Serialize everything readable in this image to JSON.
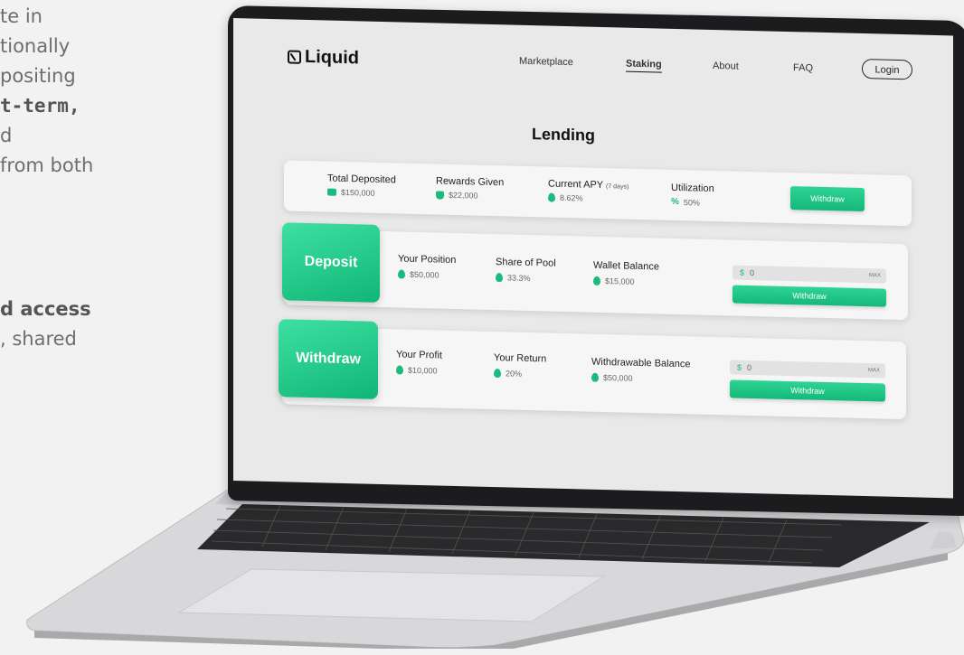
{
  "background_text": {
    "l1": "te in",
    "l2": "tionally",
    "l3": "positing",
    "l4": "t-term,",
    "l5": "d",
    "l6": "from both",
    "l7": "d access",
    "l8": ", shared"
  },
  "app": {
    "logo": "Liquid",
    "nav": [
      "Marketplace",
      "Staking",
      "About",
      "FAQ"
    ],
    "active_nav": "Staking",
    "login": "Login",
    "page_title": "Lending"
  },
  "summary": {
    "total_deposited_label": "Total Deposited",
    "total_deposited_value": "$150,000",
    "rewards_label": "Rewards Given",
    "rewards_value": "$22,000",
    "apy_label": "Current APY",
    "apy_period": "(7 days)",
    "apy_value": "8.62%",
    "utilization_label": "Utilization",
    "utilization_value": "50%",
    "withdraw_button": "Withdraw"
  },
  "deposit": {
    "tab_label": "Deposit",
    "position_label": "Your Position",
    "position_value": "$50,000",
    "share_label": "Share of Pool",
    "share_value": "33.3%",
    "wallet_label": "Wallet Balance",
    "wallet_value": "$15,000",
    "currency_symbol": "$",
    "input_value": "0",
    "max_label": "MAX",
    "button": "Withdraw"
  },
  "withdraw": {
    "tab_label": "Withdraw",
    "profit_label": "Your Profit",
    "profit_value": "$10,000",
    "return_label": "Your Return",
    "return_value": "20%",
    "balance_label": "Withdrawable Balance",
    "balance_value": "$50,000",
    "currency_symbol": "$",
    "input_value": "0",
    "max_label": "MAX",
    "button": "Withdraw"
  },
  "colors": {
    "accent": "#1dba7e",
    "accent_light": "#3ee0a2",
    "screen_bg": "#e9e9e9",
    "page_bg": "#f2f2f2"
  }
}
